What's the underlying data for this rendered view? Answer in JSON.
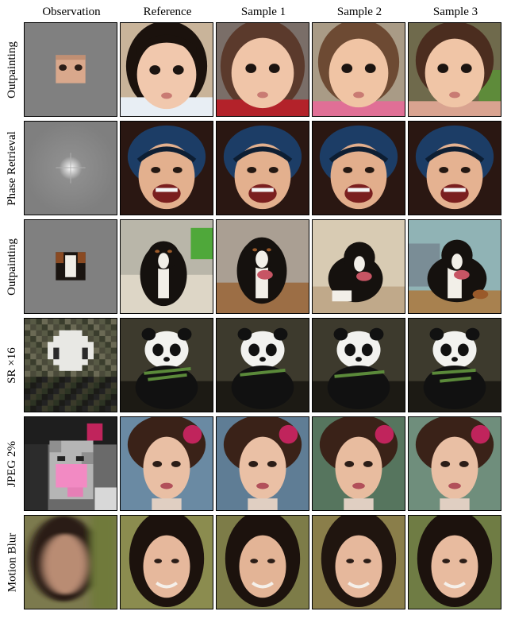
{
  "columns": {
    "observation": "Observation",
    "reference": "Reference",
    "sample1": "Sample 1",
    "sample2": "Sample 2",
    "sample3": "Sample 3"
  },
  "rows": [
    {
      "label": "Outpainting",
      "subject": "toddler-face"
    },
    {
      "label": "Phase Retrieval",
      "subject": "laughing-child"
    },
    {
      "label": "Outpainting",
      "subject": "dog"
    },
    {
      "label": "SR ×16",
      "subject": "panda"
    },
    {
      "label": "JPEG 2%",
      "subject": "woman-flower"
    },
    {
      "label": "Motion Blur",
      "subject": "woman-smiling"
    }
  ]
}
